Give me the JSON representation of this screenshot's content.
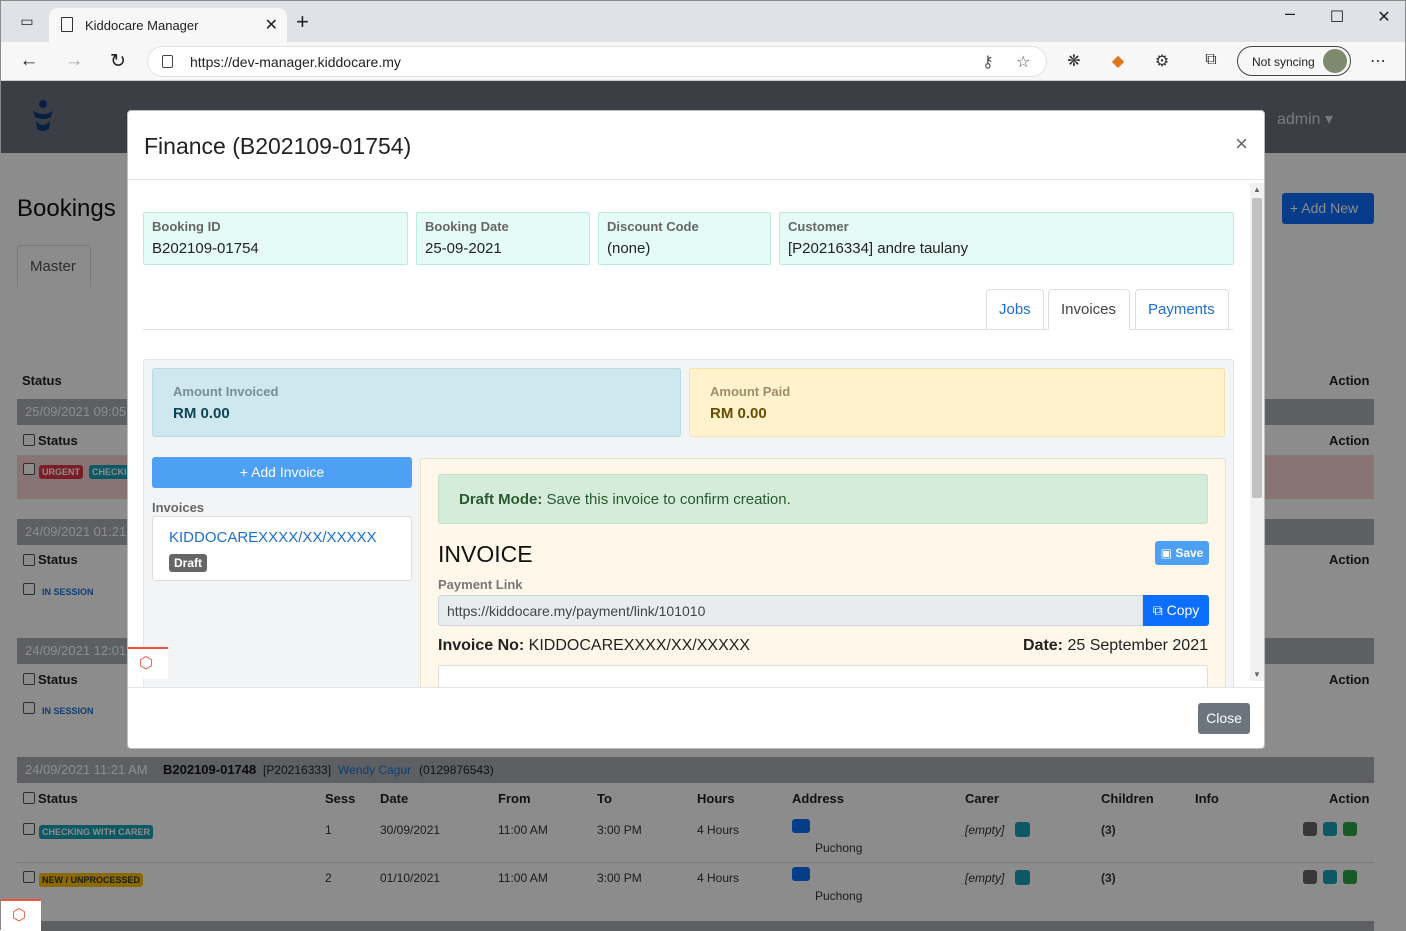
{
  "browser": {
    "tab_title": "Kiddocare Manager",
    "url": "https://dev-manager.kiddocare.my",
    "sync_label": "Not syncing"
  },
  "app": {
    "user": "admin",
    "page_title": "Bookings",
    "master_tab": "Master",
    "add_new_label": "Add New",
    "col_status": "Status",
    "col_action": "Action",
    "groups": [
      {
        "header": "25/09/2021 09:05",
        "badges": [
          "URGENT",
          "CHECKI"
        ]
      },
      {
        "header": "24/09/2021 01:21",
        "badges": [
          "IN SESSION"
        ]
      },
      {
        "header": "24/09/2021 12:01",
        "badges": [
          "IN SESSION"
        ]
      }
    ],
    "last_group": {
      "datetime": "24/09/2021 11:21 AM",
      "booking_id": "B202109-01748",
      "customer_code": "[P20216333]",
      "customer_name": "Wendy Cagur",
      "phone": "(0129876543)",
      "headers": {
        "status": "Status",
        "sess": "Sess",
        "date": "Date",
        "from": "From",
        "to": "To",
        "hours": "Hours",
        "address": "Address",
        "carer": "Carer",
        "children": "Children",
        "info": "Info",
        "action": "Action"
      },
      "rows": [
        {
          "badge": "CHECKING WITH CARER",
          "badge_color": "#17a2b8",
          "sess": "1",
          "date": "30/09/2021",
          "from": "11:00 AM",
          "to": "3:00 PM",
          "hours": "4 Hours",
          "address": "Puchong",
          "carer": "[empty]",
          "children": "(3)"
        },
        {
          "badge": "NEW / UNPROCESSED",
          "badge_color": "#ffc107",
          "sess": "2",
          "date": "01/10/2021",
          "from": "11:00 AM",
          "to": "3:00 PM",
          "hours": "4 Hours",
          "address": "Puchong",
          "carer": "[empty]",
          "children": "(3)"
        }
      ]
    }
  },
  "modal": {
    "title": "Finance (B202109-01754)",
    "close_x": "×",
    "info": [
      {
        "label": "Booking ID",
        "value": "B202109-01754"
      },
      {
        "label": "Booking Date",
        "value": "25-09-2021"
      },
      {
        "label": "Discount Code",
        "value": "(none)"
      },
      {
        "label": "Customer",
        "value": "[P20216334] andre taulany"
      }
    ],
    "tabs": [
      "Jobs",
      "Invoices",
      "Payments"
    ],
    "active_tab": "Invoices",
    "amount_invoiced_label": "Amount Invoiced",
    "amount_invoiced_value": "RM 0.00",
    "amount_paid_label": "Amount Paid",
    "amount_paid_value": "RM 0.00",
    "add_invoice_label": "Add Invoice",
    "invoices_label": "Invoices",
    "invoice_link": "KIDDOCAREXXXX/XX/XXXXX",
    "invoice_badge": "Draft",
    "draft_strong": "Draft Mode:",
    "draft_text": " Save this invoice to confirm creation.",
    "invoice_heading": "INVOICE",
    "save_label": "Save",
    "payment_link_label": "Payment Link",
    "payment_link_value": "https://kiddocare.my/payment/link/101010",
    "copy_label": "Copy",
    "invoice_no_label": "Invoice No:",
    "invoice_no_value": " KIDDOCAREXXXX/XX/XXXXX",
    "date_label": "Date:",
    "date_value": " 25 September 2021",
    "close_label": "Close"
  },
  "colors": {
    "primary": "#0d6efd",
    "info_bg": "#e4fbf6",
    "invoiced_bg": "#cfe8ef",
    "paid_bg": "#fff2cc",
    "draft_bg": "#d4ecd9"
  }
}
